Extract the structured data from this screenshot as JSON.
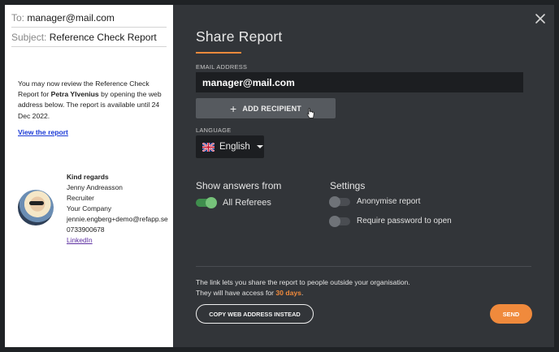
{
  "email_preview": {
    "to_label": "To:",
    "to_value": "manager@mail.com",
    "subject_label": "Subject:",
    "subject_value": "Reference Check Report",
    "body_part1": "You may now review the Reference Check Report for ",
    "candidate_name": "Petra Ylvenius",
    "body_part2": " by opening the web address below. The report is available until 24 Dec 2022.",
    "view_link": "View the report",
    "signature": {
      "greeting": "Kind regards",
      "name": "Jenny Andreasson",
      "role": "Recruiter",
      "company": "Your Company",
      "email": "jennie.engberg+demo@refapp.se",
      "phone": "0733900678",
      "link": "LinkedIn"
    }
  },
  "dialog": {
    "title": "Share Report",
    "email_label": "EMAIL ADDRESS",
    "email_value": "manager@mail.com",
    "add_recipient": "ADD RECIPIENT",
    "language_label": "LANGUAGE",
    "language_value": "English",
    "show_answers_title": "Show answers from",
    "all_referees": "All Referees",
    "all_referees_on": true,
    "settings_title": "Settings",
    "anonymise": "Anonymise report",
    "anonymise_on": false,
    "require_password": "Require password to open",
    "require_password_on": false,
    "info_line1": "The link lets you share the report to people outside your organisation.",
    "info_line2_prefix": "They will have access for ",
    "info_days": "30 days",
    "info_line2_suffix": ".",
    "copy_button": "COPY WEB ADDRESS INSTEAD",
    "send_button": "SEND"
  },
  "colors": {
    "accent": "#f08a3c",
    "toggle_on": "#76c27a",
    "dialog_bg": "#323539",
    "link_blue": "#1a39d6"
  },
  "icons": [
    "close-icon",
    "plus-icon",
    "uk-flag-icon",
    "chevron-down-icon",
    "pointer-cursor-icon"
  ]
}
